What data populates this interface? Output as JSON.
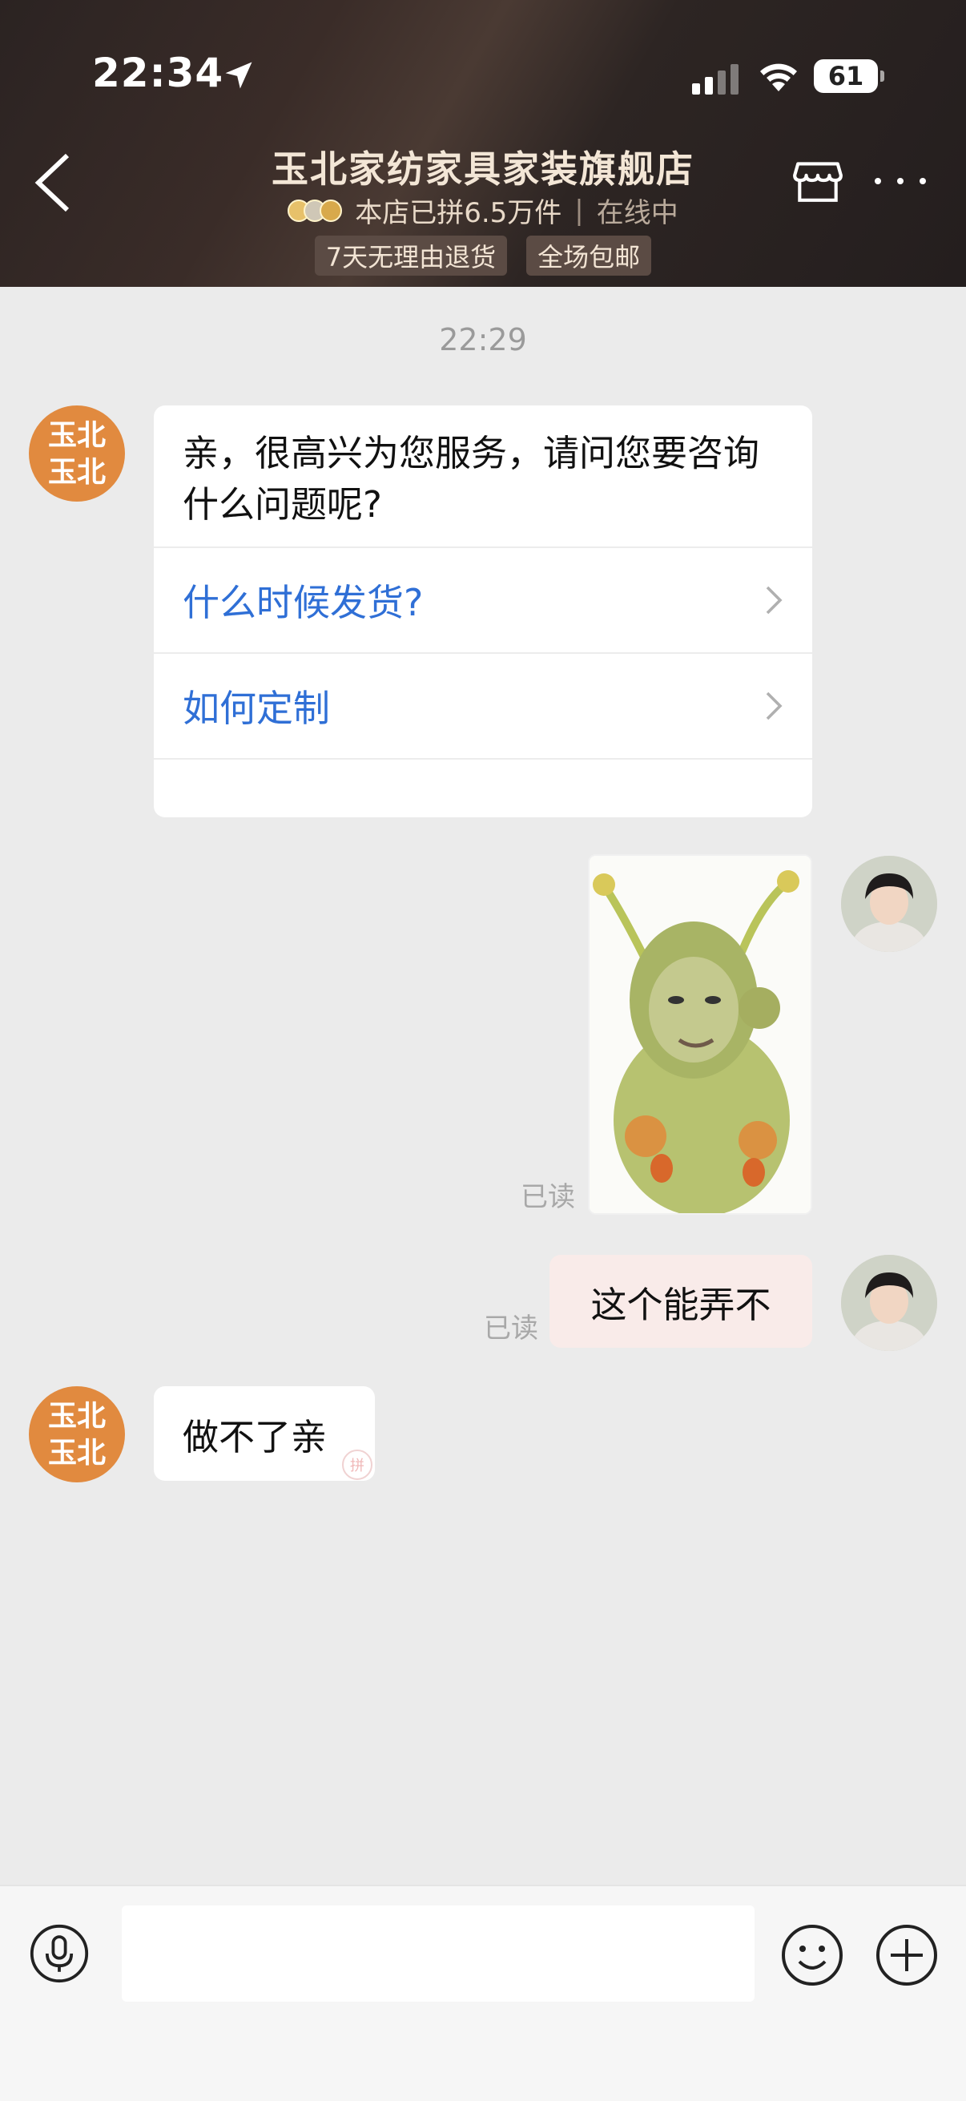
{
  "status_bar": {
    "time": "22:34",
    "battery": "61"
  },
  "header": {
    "shop_name": "玉北家纺家具家装旗舰店",
    "sales": "本店已拼6.5万件",
    "separator": "|",
    "online": "在线中",
    "tags": [
      "7天无理由退货",
      "全场包邮"
    ]
  },
  "chat": {
    "timestamp": "22:29",
    "shop_avatar_text": [
      "玉北",
      "玉北"
    ],
    "greeting": "亲，很高兴为您服务，请问您要咨询什么问题呢?",
    "quick_questions": [
      "什么时候发货?",
      "如何定制"
    ],
    "read_label": "已读",
    "user_message": "这个能弄不",
    "shop_reply": "做不了亲",
    "pin_badge": "拼"
  },
  "colors": {
    "shop_avatar": "#e18a3f",
    "link_blue": "#2f6fd6",
    "user_bubble": "#f9ebe9"
  }
}
